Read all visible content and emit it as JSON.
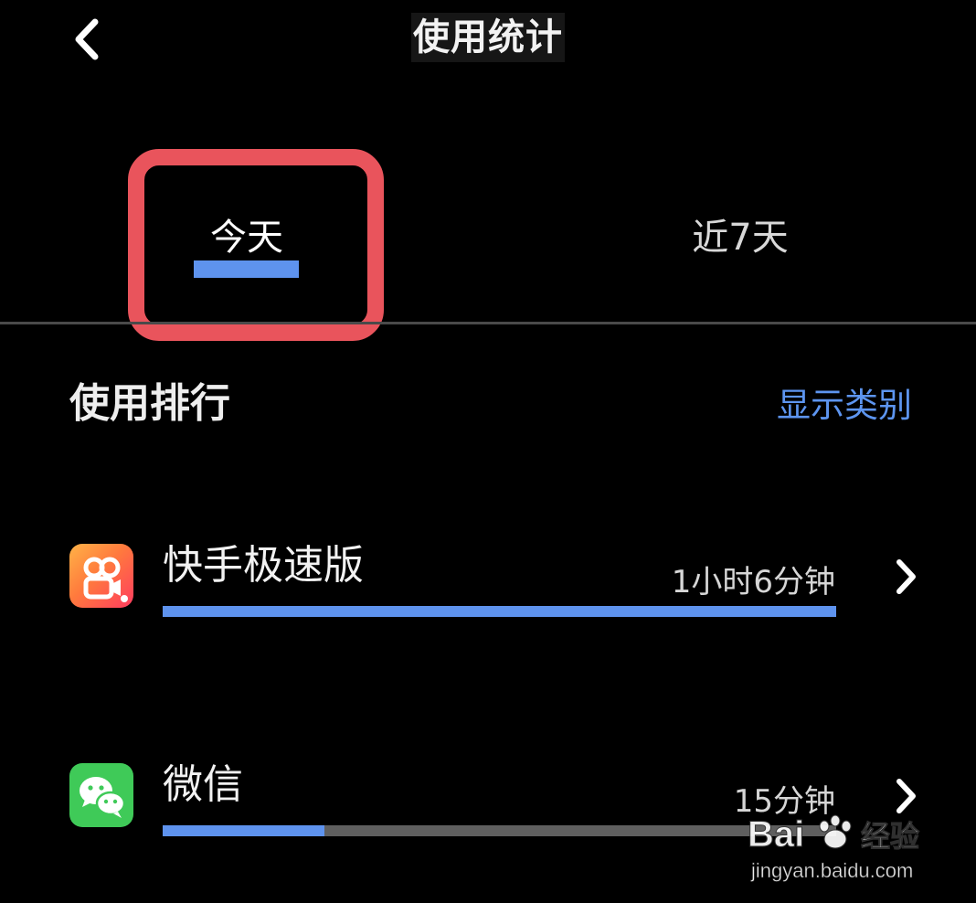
{
  "header": {
    "title": "使用统计",
    "back_icon": "chevron-left-icon"
  },
  "tabs": [
    {
      "label": "今天",
      "selected": true
    },
    {
      "label": "近7天",
      "selected": false
    }
  ],
  "section": {
    "title": "使用排行",
    "action_label": "显示类别"
  },
  "apps": [
    {
      "name": "快手极速版",
      "duration": "1小时6分钟",
      "usage_fraction": 1.0,
      "icon": "kuaishou-lite-icon"
    },
    {
      "name": "微信",
      "duration": "15分钟",
      "usage_fraction": 0.24,
      "icon": "wechat-icon"
    }
  ],
  "colors": {
    "accent": "#5e93ee",
    "highlight_box": "#e9545c",
    "background": "#000000",
    "track": "#5f5f5f"
  },
  "watermark": {
    "brand": "Bai du 经验",
    "url": "jingyan.baidu.com"
  }
}
